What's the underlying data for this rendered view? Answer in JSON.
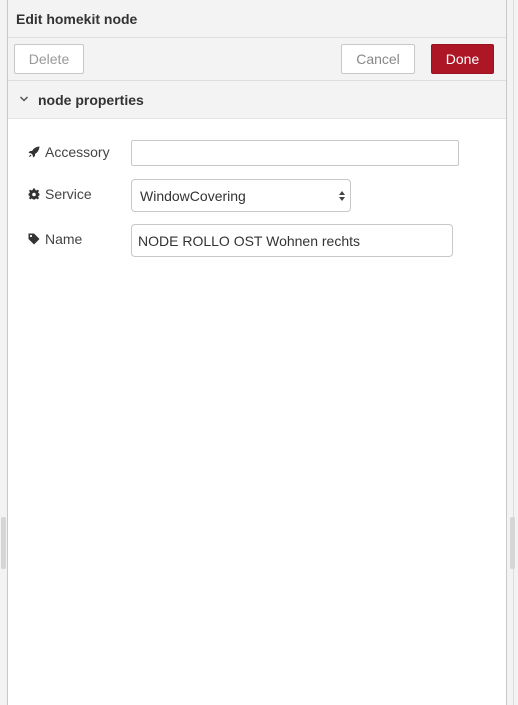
{
  "header": {
    "title": "Edit homekit node"
  },
  "toolbar": {
    "delete_label": "Delete",
    "cancel_label": "Cancel",
    "done_label": "Done"
  },
  "section": {
    "title": "node properties"
  },
  "fields": {
    "accessory": {
      "label": "Accessory",
      "icon": "rocket-icon",
      "value": ""
    },
    "service": {
      "label": "Service",
      "icon": "gear-icon",
      "value": "WindowCovering"
    },
    "name": {
      "label": "Name",
      "icon": "tag-icon",
      "value": "NODE ROLLO OST Wohnen rechts"
    }
  },
  "colors": {
    "done_button": "#ad1625",
    "header_bg": "#f3f3f3"
  }
}
